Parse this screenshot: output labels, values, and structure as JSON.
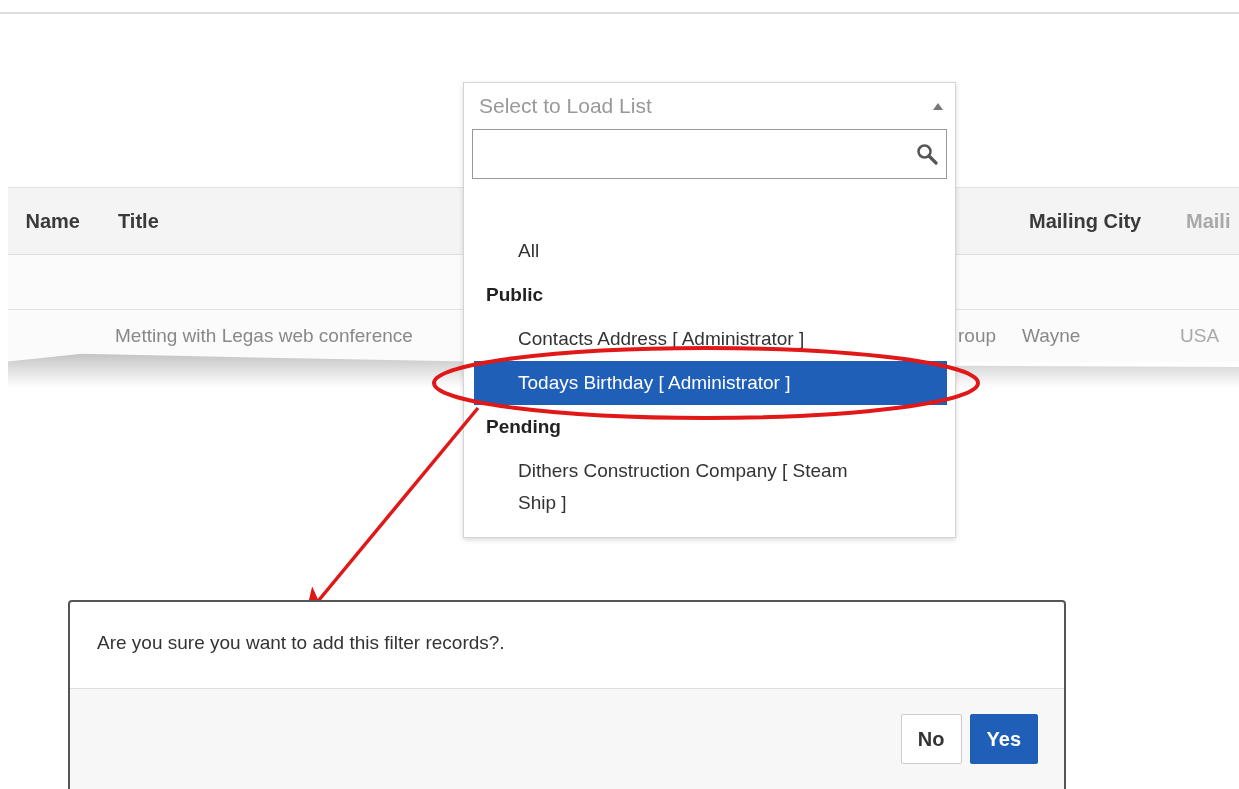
{
  "table": {
    "columns": [
      {
        "heading": "Name",
        "faded": false
      },
      {
        "heading": "Title",
        "faded": false
      },
      {},
      {
        "heading": "Mailing City",
        "faded": false
      },
      {
        "heading": "Maili",
        "faded": true
      }
    ],
    "rows": [
      {
        "cells": [
          {},
          {
            "text": "Metting with Legas web conference",
            "faded": false
          },
          {
            "text": "roup",
            "faded": false
          },
          {
            "text": "Wayne",
            "faded": false
          },
          {
            "text": "USA",
            "faded": true
          }
        ]
      }
    ]
  },
  "list_select": {
    "placeholder": "Select to Load List",
    "expanded": true,
    "options": [
      {
        "kind": "option",
        "label": "All",
        "selected": false
      },
      {
        "kind": "group",
        "label": "Public"
      },
      {
        "kind": "option",
        "label": "Contacts Address [ Administrator ]",
        "selected": false
      },
      {
        "kind": "option",
        "label": "Todays Birthday [ Administrator ]",
        "selected": true
      },
      {
        "kind": "group",
        "label": "Pending"
      },
      {
        "kind": "option",
        "label": "Dithers Construction Company [ Steam Ship ]",
        "selected": false
      }
    ]
  },
  "dialog": {
    "message": "Are you sure you want to add this filter records?.",
    "buttons": [
      {
        "label": "No",
        "primary": false
      },
      {
        "label": "Yes",
        "primary": true
      }
    ]
  }
}
